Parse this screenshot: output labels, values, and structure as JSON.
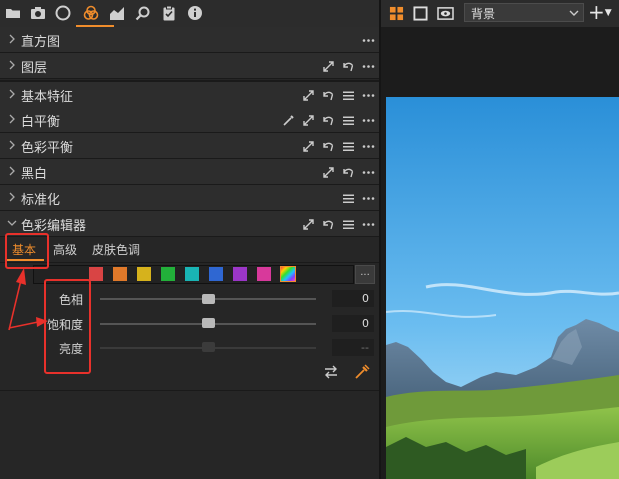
{
  "toolbar": {
    "icons": [
      "folder-icon",
      "camera-icon",
      "lens-icon",
      "color-icon",
      "exposure-icon",
      "search-icon",
      "clipboard-icon",
      "info-icon"
    ],
    "active": "color-icon"
  },
  "tools": [
    {
      "title": "直方图",
      "icons": [
        "more-icon"
      ]
    },
    {
      "title": "图层",
      "icons": [
        "expand-icon",
        "reset-icon",
        "more-icon"
      ]
    },
    {
      "title": "基本特征",
      "icons": [
        "expand-icon",
        "reset-icon",
        "menu-icon",
        "more-icon"
      ]
    },
    {
      "title": "白平衡",
      "icons": [
        "picker-icon",
        "expand-icon",
        "reset-icon",
        "menu-icon",
        "more-icon"
      ]
    },
    {
      "title": "色彩平衡",
      "icons": [
        "expand-icon",
        "reset-icon",
        "menu-icon",
        "more-icon"
      ]
    },
    {
      "title": "黑白",
      "icons": [
        "expand-icon",
        "reset-icon",
        "more-icon"
      ]
    },
    {
      "title": "标准化",
      "icons": [
        "menu-icon",
        "more-icon"
      ]
    },
    {
      "title": "色彩编辑器",
      "icons": [
        "expand-icon",
        "reset-icon",
        "menu-icon",
        "more-icon"
      ]
    }
  ],
  "color_editor": {
    "tabs": [
      "基本",
      "高级",
      "皮肤色调"
    ],
    "active_tab": "基本",
    "swatch_colors": [
      "#d94444",
      "#e0792a",
      "#d6b21c",
      "#22b03a",
      "#19b4b4",
      "#2f67d2",
      "#9b36c8",
      "#d8399b"
    ],
    "more_label": "...",
    "sliders": [
      {
        "label": "色相",
        "value": "0",
        "level": 0.5,
        "enabled": true
      },
      {
        "label": "饱和度",
        "value": "0",
        "level": 0.5,
        "enabled": true
      },
      {
        "label": "亮度",
        "value": "--",
        "level": 0.5,
        "enabled": false
      }
    ]
  },
  "viewer": {
    "layout_icons": [
      "grid-icon",
      "single-view-icon",
      "eye-icon"
    ],
    "background_select": "背景",
    "add_label": "+"
  },
  "colors": {
    "accent": "#f08d2c",
    "annotation": "#e8312b"
  }
}
